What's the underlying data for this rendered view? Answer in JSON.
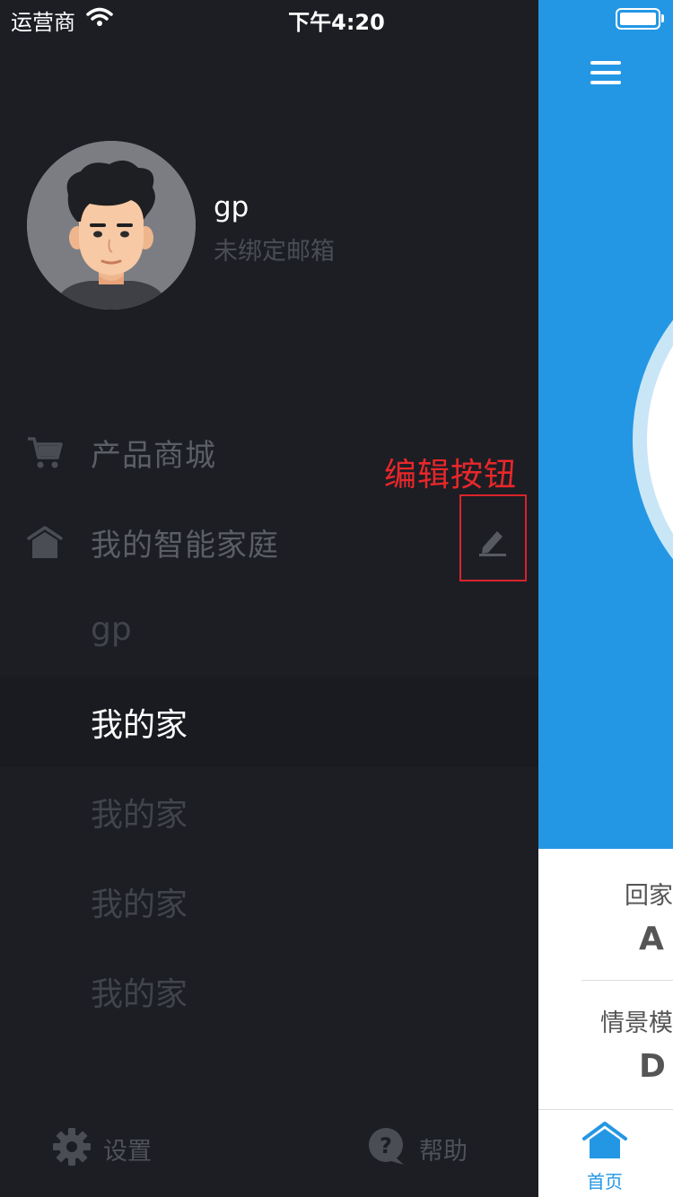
{
  "status_bar": {
    "carrier": "运营商",
    "time": "下午4:20"
  },
  "user": {
    "name": "gp",
    "email_status": "未绑定邮箱"
  },
  "menu": {
    "shop_label": "产品商城",
    "home_label": "我的智能家庭"
  },
  "annotation": {
    "edit_button_note": "编辑按钮"
  },
  "homes": [
    "gp",
    "我的家",
    "我的家",
    "我的家",
    "我的家"
  ],
  "active_home_index": 1,
  "footer": {
    "settings_label": "设置",
    "help_label": "帮助"
  },
  "right_panel": {
    "scene_1_name": "回家",
    "scene_1_key": "A",
    "scene_2_name": "情景模",
    "scene_2_key": "D",
    "tab_home_label": "首页"
  },
  "colors": {
    "drawer_bg": "#1c1e24",
    "accent_blue": "#2497e4",
    "annotation_red": "#e8272a"
  }
}
